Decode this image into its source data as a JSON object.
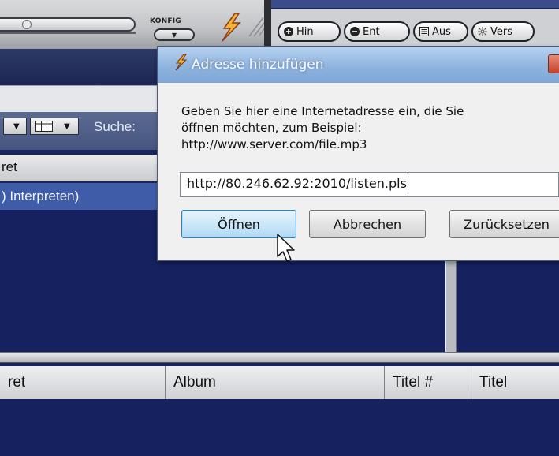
{
  "player": {
    "konfig_label": "KONFIG",
    "pills": [
      {
        "label": "Hin",
        "icon": "plus-icon"
      },
      {
        "label": "Ent",
        "icon": "minus-icon"
      },
      {
        "label": "Aus",
        "icon": "list-icon"
      },
      {
        "label": "Vers",
        "icon": "sparkle-icon"
      }
    ]
  },
  "library": {
    "search_label": "Suche:",
    "top_column_header": "ret",
    "top_row": ") Interpreten)",
    "bottom_columns": [
      "ret",
      "Album",
      "Titel #",
      "Titel"
    ]
  },
  "dialog": {
    "title": "Adresse hinzufügen",
    "message_lines": [
      "Geben Sie hier eine Internetadresse ein, die Sie",
      "öffnen möchten, zum Beispiel:",
      "http://www.server.com/file.mp3"
    ],
    "url_value": "http://80.246.62.92:2010/listen.pls",
    "buttons": {
      "open": "Öffnen",
      "cancel": "Abbrechen",
      "reset": "Zurücksetzen"
    }
  },
  "colors": {
    "list_background": "#162160",
    "selected_row": "#3e5ca8",
    "dialog_title_bar": "#8fb4df"
  }
}
